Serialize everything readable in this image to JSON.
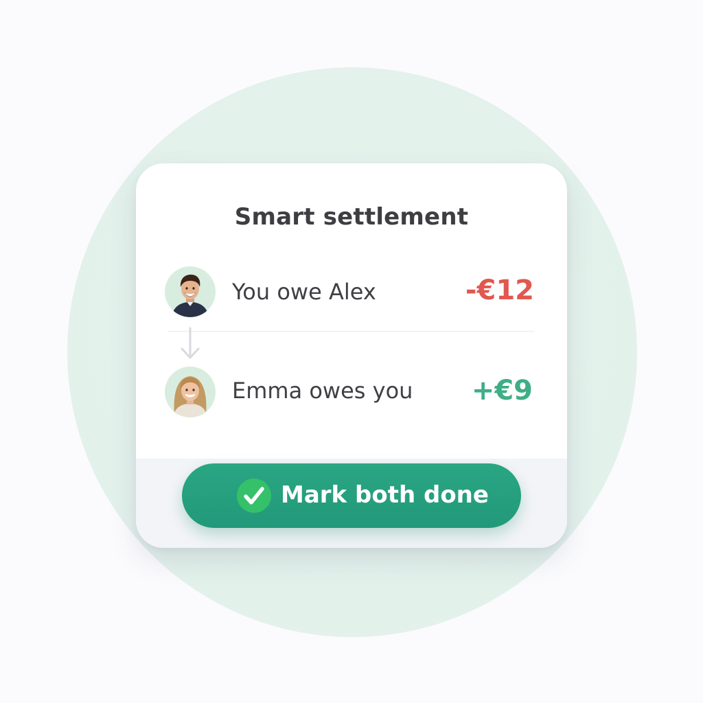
{
  "card": {
    "title": "Smart settlement"
  },
  "rows": [
    {
      "text": "You owe Alex",
      "amount": "-€12",
      "amount_color": "#e0584f",
      "avatar_icon": "man-avatar-icon"
    },
    {
      "text": "Emma owes you",
      "amount": "+€9",
      "amount_color": "#3eae86",
      "avatar_icon": "woman-avatar-icon"
    }
  ],
  "action": {
    "label": "Mark both done",
    "icon": "checkmark-icon",
    "color": "#249d7d"
  },
  "colors": {
    "background_circle": "#e4f2ec",
    "card": "#ffffff",
    "negative": "#e0584f",
    "positive": "#3eae86"
  }
}
